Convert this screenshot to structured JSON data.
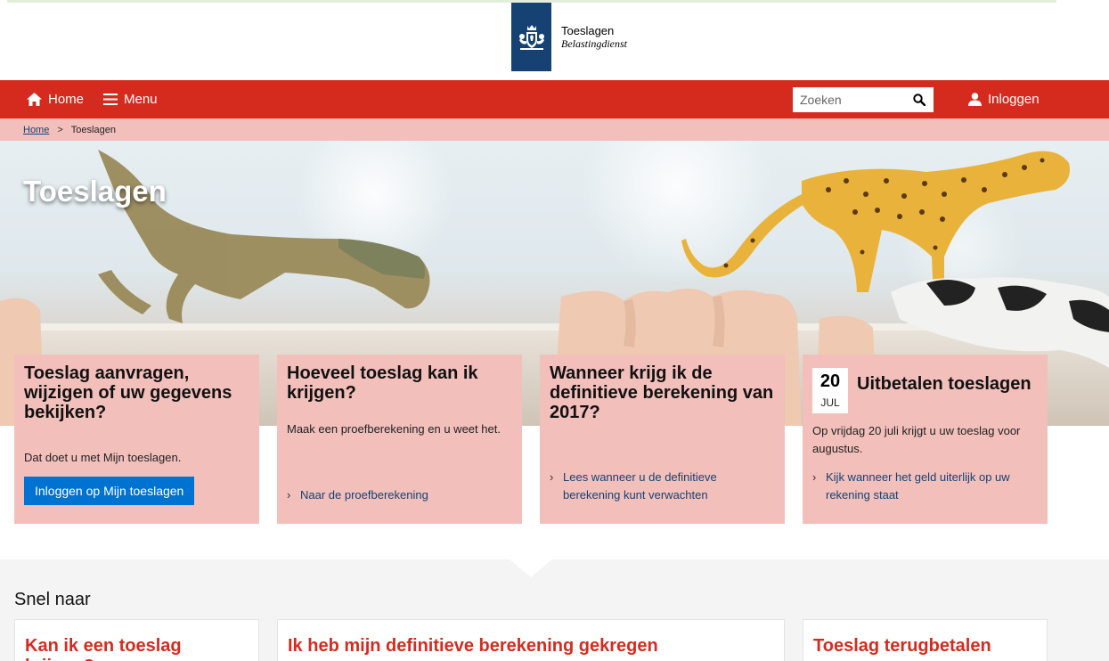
{
  "header": {
    "logo_line1": "Toeslagen",
    "logo_line2": "Belastingdienst",
    "logo_color": "#154273"
  },
  "nav": {
    "home_label": "Home",
    "menu_label": "Menu",
    "search_placeholder": "Zoeken",
    "login_label": "Inloggen",
    "bar_color": "#d52b1e"
  },
  "breadcrumb": {
    "home": "Home",
    "separator": ">",
    "current": "Toeslagen"
  },
  "hero": {
    "title": "Toeslagen"
  },
  "cards": [
    {
      "title": "Toeslag aanvragen, wijzigen of uw gegevens bekijken?",
      "text": "Dat doet u met Mijn toeslagen.",
      "button": "Inloggen op Mijn toeslagen"
    },
    {
      "title": "Hoeveel toeslag kan ik krijgen?",
      "text": "Maak een proefberekening en u weet het.",
      "link": "Naar de proefberekening"
    },
    {
      "title": "Wanneer krijg ik de definitieve berekening van 2017?",
      "link": "Lees wanneer u de definitieve berekening kunt verwachten"
    },
    {
      "date_day": "20",
      "date_month": "JUL",
      "title": "Uitbetalen toeslagen",
      "text": "Op vrijdag 20 juli krijgt u uw toeslag voor augustus.",
      "link": "Kijk wanneer het geld uiterlijk op uw rekening staat"
    }
  ],
  "quick": {
    "title": "Snel naar",
    "items": [
      "Kan ik een toeslag krijgen?",
      "Ik heb mijn definitieve berekening gekregen",
      "Toeslag terugbetalen"
    ]
  },
  "icons": {
    "home": "home-icon",
    "menu": "hamburger-icon",
    "search": "search-icon",
    "user": "user-icon",
    "chevron": "chevron-right-icon"
  }
}
